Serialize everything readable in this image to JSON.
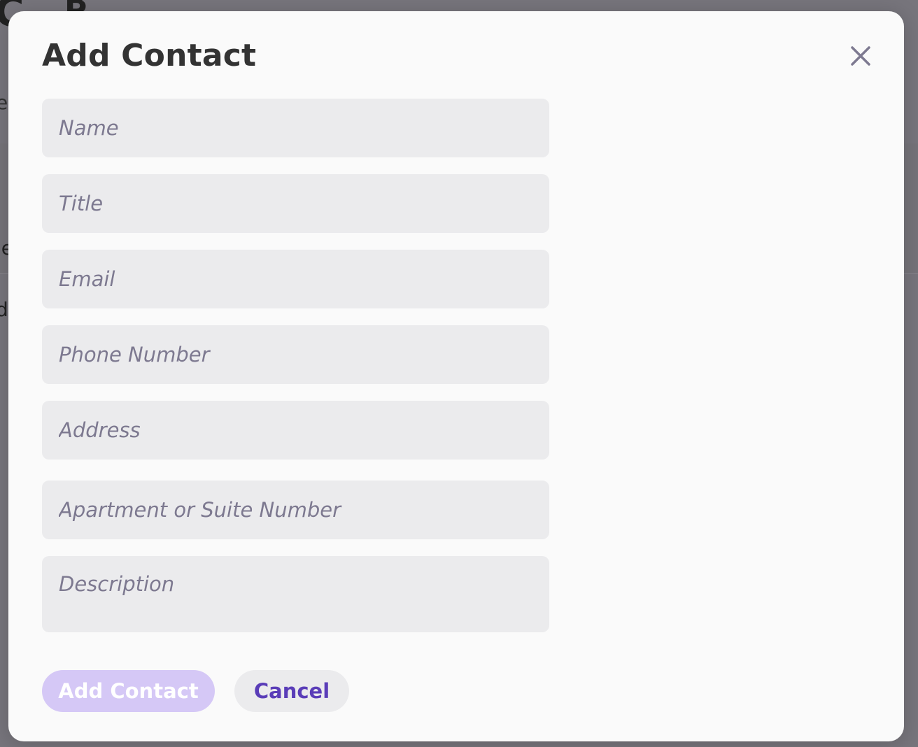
{
  "modal": {
    "title": "Add Contact",
    "close_icon": "close-icon",
    "fields": {
      "name": {
        "placeholder": "Name",
        "value": ""
      },
      "title": {
        "placeholder": "Title",
        "value": ""
      },
      "email": {
        "placeholder": "Email",
        "value": ""
      },
      "phone": {
        "placeholder": "Phone Number",
        "value": ""
      },
      "address": {
        "placeholder": "Address",
        "value": ""
      },
      "apartment": {
        "placeholder": "Apartment or Suite Number",
        "value": ""
      },
      "description": {
        "placeholder": "Description",
        "value": ""
      }
    },
    "buttons": {
      "add_label": "Add Contact",
      "cancel_label": "Cancel"
    }
  },
  "background": {
    "glyphs": [
      "C",
      "B",
      "e",
      "le",
      "d"
    ]
  },
  "colors": {
    "overlay": "#77757c",
    "modal_bg": "#fafafa",
    "field_bg": "#ebebed",
    "placeholder": "#7d7990",
    "primary_disabled": "#d5c8f6",
    "accent": "#5a3db8",
    "close_icon": "#7d7990"
  }
}
